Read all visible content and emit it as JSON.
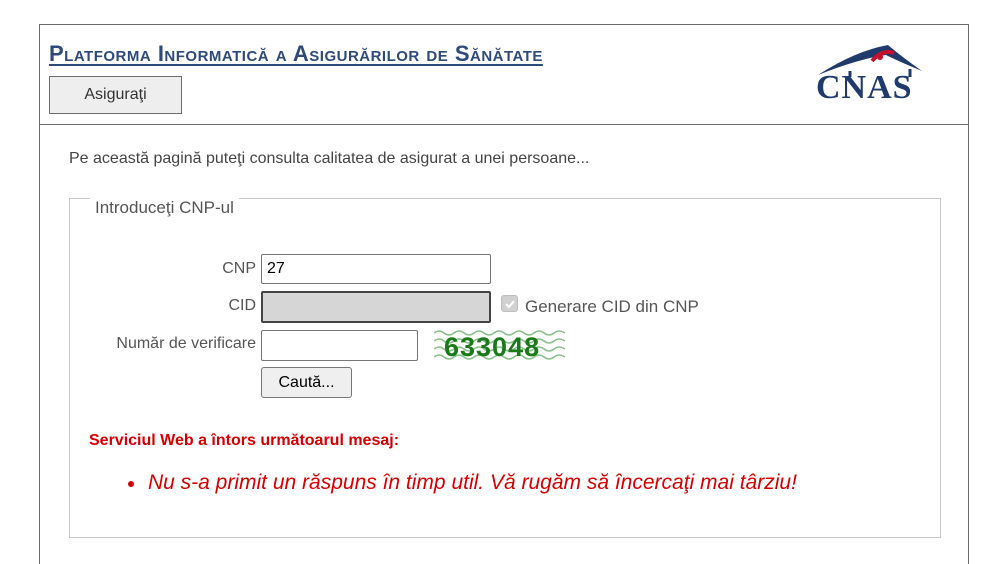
{
  "header": {
    "title": "Platforma Informatică a Asigurărilor de Sănătate",
    "tab_label": "Asiguraţi",
    "logo_text": "CNAS"
  },
  "intro_text": "Pe această pagină puteţi consulta calitatea de asigurat a unei persoane...",
  "form": {
    "legend": "Introduceţi CNP-ul",
    "cnp_label": "CNP",
    "cnp_value": "27",
    "cid_label": "CID",
    "cid_value": "",
    "generate_cid_label": "Generare CID din CNP",
    "generate_cid_checked": true,
    "verify_label": "Număr de verificare",
    "verify_value": "",
    "captcha_text": "633048",
    "search_label": "Caută..."
  },
  "error": {
    "title": "Serviciul Web a întors următoarul mesaj:",
    "messages": [
      "Nu s-a primit un răspuns în timp util. Vă rugăm să încercaţi mai târziu!"
    ]
  },
  "colors": {
    "title": "#2e4a7a",
    "error": "#d40000",
    "captcha": "#1a7a1a"
  }
}
